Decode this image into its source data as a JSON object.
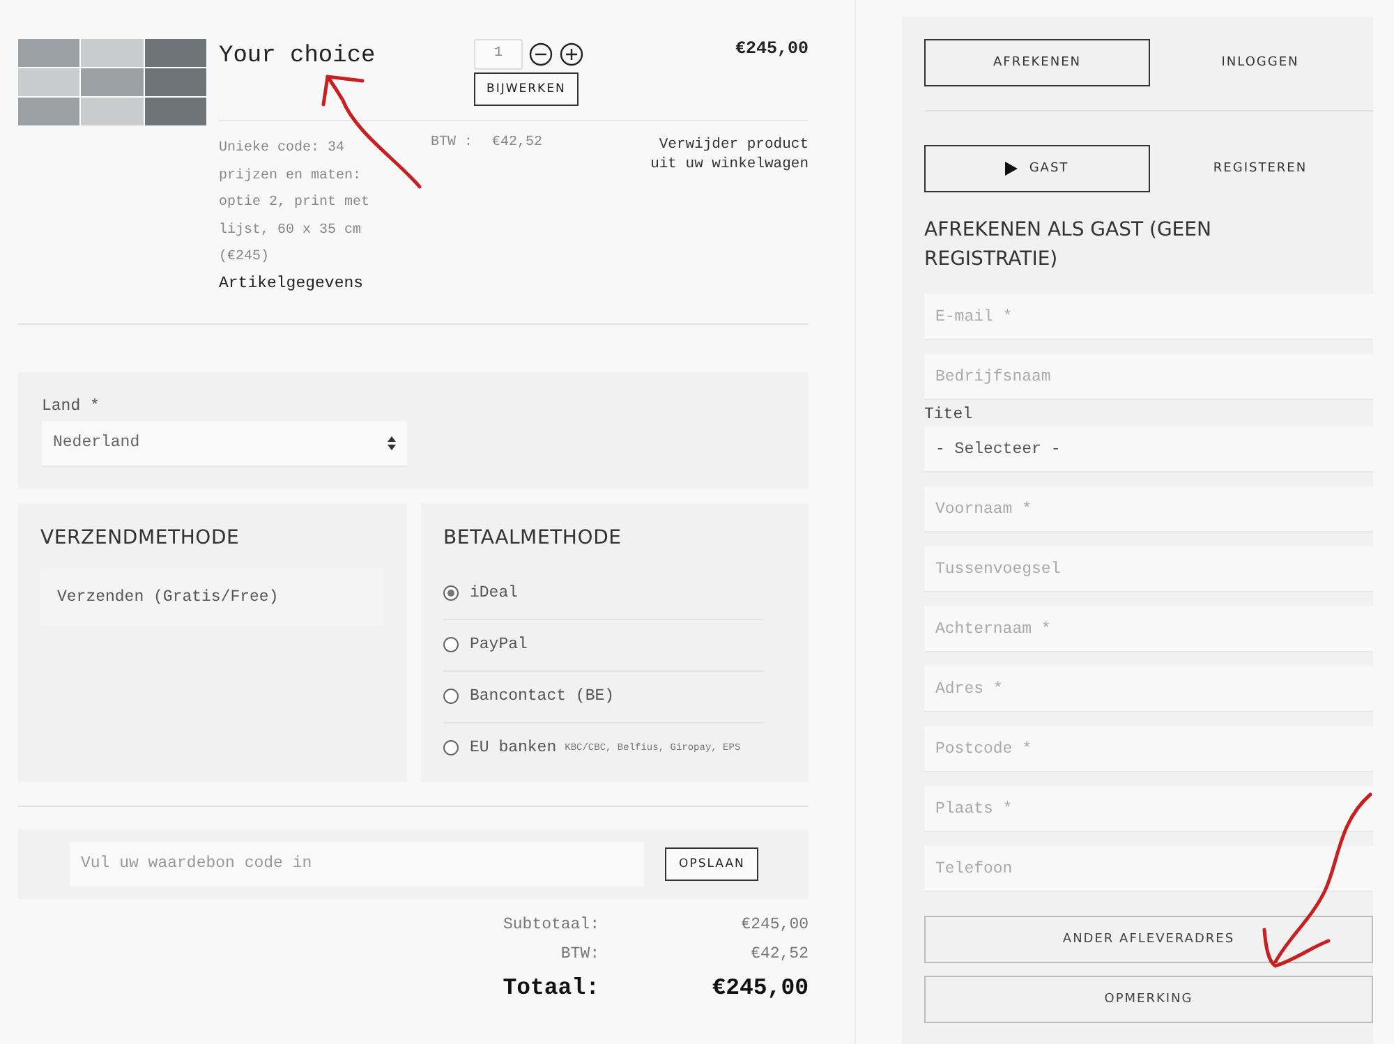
{
  "product": {
    "title": "Your choice",
    "quantity": "1",
    "update_button": "BIJWERKEN",
    "price": "€245,00",
    "details": [
      "Unieke code: 34",
      "prijzen en maten: optie 2, print met lijst, 60 x 35 cm (€245)"
    ],
    "details_link": "Artikelgegevens",
    "vat_label": "BTW :",
    "vat_value": "€42,52",
    "remove_link": "Verwijder product uit uw winkelwagen"
  },
  "country": {
    "label": "Land *",
    "value": "Nederland"
  },
  "shipping": {
    "title": "VERZENDMETHODE",
    "options": [
      {
        "label": "Verzenden (Gratis/Free)"
      }
    ]
  },
  "payment": {
    "title": "BETAALMETHODE",
    "options": [
      {
        "label": "iDeal",
        "selected": true
      },
      {
        "label": "PayPal",
        "selected": false
      },
      {
        "label": "Bancontact (BE)",
        "selected": false
      },
      {
        "label": "EU banken",
        "note": "KBC/CBC, Belfius, Giropay, EPS",
        "selected": false
      }
    ]
  },
  "coupon": {
    "placeholder": "Vul uw waardebon code in",
    "button": "OPSLAAN"
  },
  "totals": [
    {
      "label": "Subtotaal:",
      "value": "€245,00",
      "kind": "line"
    },
    {
      "label": "BTW:",
      "value": "€42,52",
      "kind": "line"
    },
    {
      "label": "Totaal:",
      "value": "€245,00",
      "kind": "total"
    }
  ],
  "checkout": {
    "tabs": [
      {
        "label": "AFREKENEN",
        "selected": true,
        "arrow": false
      },
      {
        "label": "INLOGGEN",
        "selected": false,
        "arrow": false
      }
    ],
    "guest_tabs": [
      {
        "label": "GAST",
        "selected": true,
        "arrow": true
      },
      {
        "label": "REGISTEREN",
        "selected": false,
        "arrow": false
      }
    ],
    "heading": "AFREKENEN ALS GAST (GEEN REGISTRATIE)",
    "fields": [
      {
        "kind": "input",
        "placeholder": "E-mail *"
      },
      {
        "kind": "input",
        "placeholder": "Bedrijfsnaam"
      },
      {
        "kind": "select",
        "label": "Titel",
        "value": "- Selecteer -"
      },
      {
        "kind": "input",
        "placeholder": "Voornaam *"
      },
      {
        "kind": "input",
        "placeholder": "Tussenvoegsel"
      },
      {
        "kind": "input",
        "placeholder": "Achternaam *"
      },
      {
        "kind": "input",
        "placeholder": "Adres *"
      },
      {
        "kind": "input",
        "placeholder": "Postcode *"
      },
      {
        "kind": "input",
        "placeholder": "Plaats *"
      },
      {
        "kind": "input",
        "placeholder": "Telefoon"
      }
    ],
    "buttons": [
      "ANDER AFLEVERADRES",
      "OPMERKING"
    ]
  }
}
